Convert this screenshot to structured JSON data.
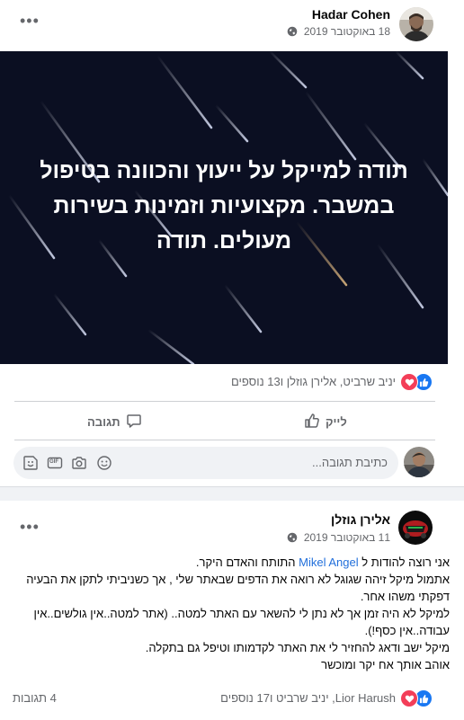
{
  "post1": {
    "author": "Hadar Cohen",
    "date": "18 באוקטובר 2019",
    "menu": "•••",
    "image_text": "תודה למייקל על ייעוץ והכוונה בטיפול במשבר. מקצועיות וזמינות בשירות מעולים. תודה",
    "reactions_text": "יניב שרביט, אלירן גוזלן ו13 נוספים",
    "like_label": "לייק",
    "comment_label": "תגובה",
    "comment_placeholder": "כתיבת תגובה...",
    "gif_label": "GIF",
    "colors": {
      "bg": "#0b0f22",
      "like_blue": "#1877f2",
      "love_red": "#f33e58"
    }
  },
  "post2": {
    "author": "אלירן גוזלן",
    "date": "11 באוקטובר 2019",
    "menu": "•••",
    "body": {
      "line1_before": "אני רוצה להודות ל ",
      "mention": "Mikel Angel",
      "line1_after": " התותח והאדם היקר.",
      "line2": "אתמול מיקל זיהה שגוגל לא רואה את הדפים שבאתר שלי , אך כשניביתי לתקן את הבעיה דפקתי משהו אחר.",
      "line3": "למיקל לא היה זמן אך לא נתן לי להשאר עם האתר למטה.. (אתר למטה..אין גולשים..אין עבודה..אין כסף!).",
      "line4": "מיקל ישב ודאג להחזיר לי את האתר לקדמותו וטיפל גם בתקלה.",
      "line5": "אוהב אותך אח יקר ומוכשר"
    },
    "reactions_text": "Lior Harush, יניב שרביט ו17 נוספים",
    "comments_count": "4 תגובות"
  }
}
